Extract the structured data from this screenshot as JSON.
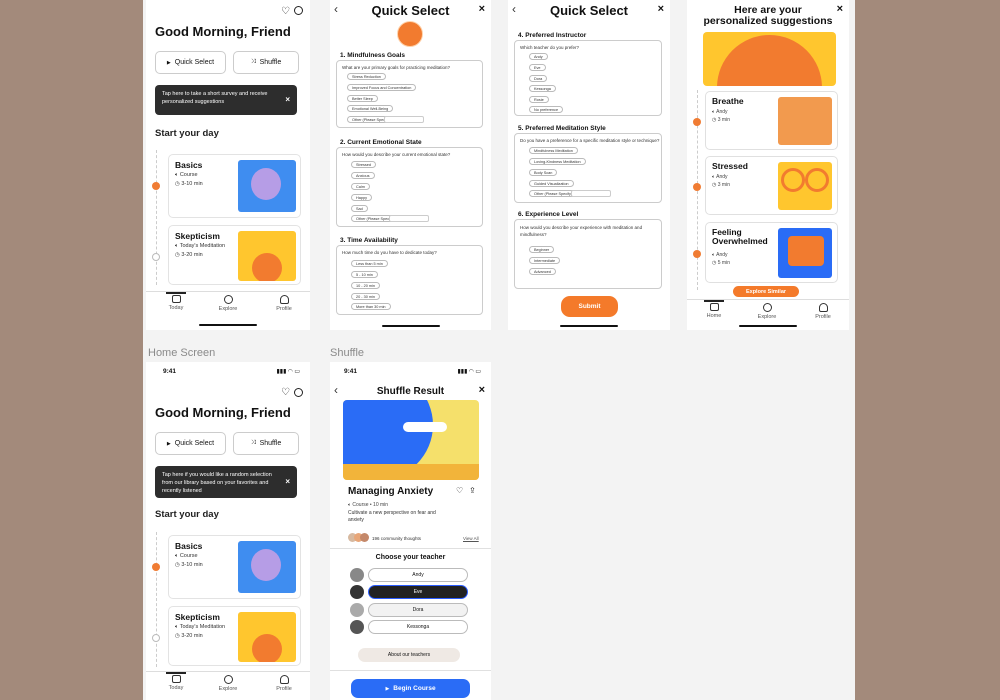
{
  "labels": {
    "home": "Home Screen",
    "shuffle": "Shuffle"
  },
  "home1": {
    "greeting": "Good Morning, Friend",
    "quick_select": "Quick Select",
    "shuffle": "Shuffle",
    "tooltip": "Tap here to take a short survey and receive personalized suggestions",
    "section": "Start your day",
    "cards": [
      {
        "title": "Basics",
        "type": "Course",
        "duration": "3-10 min"
      },
      {
        "title": "Skepticism",
        "type": "Today's Meditation",
        "duration": "3-20 min"
      }
    ],
    "tabs": [
      "Today",
      "Explore",
      "Profile"
    ]
  },
  "home2": {
    "time": "9:41",
    "greeting": "Good Morning, Friend",
    "quick_select": "Quick Select",
    "shuffle": "Shuffle",
    "tooltip": "Tap here if you would like a random selection from our library based on your favorites and recently listened",
    "section": "Start your day",
    "cards": [
      {
        "title": "Basics",
        "type": "Course",
        "duration": "3-10 min"
      },
      {
        "title": "Skepticism",
        "type": "Today's Meditation",
        "duration": "3-20 min"
      }
    ],
    "tabs": [
      "Today",
      "Explore",
      "Profile"
    ]
  },
  "qs1": {
    "title": "Quick Select",
    "q1": {
      "title": "1.  Mindfulness Goals",
      "sub": "What are your primary goals for practicing meditation?",
      "options": [
        "Stress Reduction",
        "Improved Focus and Concentration",
        "Better Sleep",
        "Emotional Well-Being",
        "Other (Please Specify)"
      ]
    },
    "q2": {
      "title": "2.  Current Emotional State",
      "sub": "How would you describe your current emotional state?",
      "options": [
        "Stressed",
        "Anxious",
        "Calm",
        "Happy",
        "Sad",
        "Other (Please Specify)"
      ]
    },
    "q3": {
      "title": "3.  Time Availability",
      "sub": "How much time do you have to dedicate today?",
      "options": [
        "Less than 5 min",
        "5 - 10 min",
        "10 - 20 min",
        "20 - 30 min",
        "More than 30 min"
      ]
    }
  },
  "qs2": {
    "title": "Quick Select",
    "q4": {
      "title": "4.  Preferred Instructor",
      "sub": "Which teacher do you prefer?",
      "options": [
        "Andy",
        "Eve",
        "Dora",
        "Kessonga",
        "Rosie",
        "No preference"
      ]
    },
    "q5": {
      "title": "5.  Preferred Meditation Style",
      "sub": "Do you have a preference for a specific meditation style or technique?",
      "options": [
        "Mindfulness Meditation",
        "Loving-Kindness Meditation",
        "Body Scan",
        "Guided Visualization",
        "Other (Please Specify)"
      ]
    },
    "q6": {
      "title": "6.  Experience Level",
      "sub": "How would you describe your experience with meditation and mindfulness?",
      "options": [
        "Beginner",
        "Intermediate",
        "Advanced"
      ]
    },
    "submit": "Submit"
  },
  "sugg": {
    "title": "Here are your personalized suggestions",
    "items": [
      {
        "title": "Breathe",
        "teacher": "Andy",
        "duration": "3 min"
      },
      {
        "title": "Stressed",
        "teacher": "Andy",
        "duration": "3 min"
      },
      {
        "title": "Feeling Overwhelmed",
        "teacher": "Andy",
        "duration": "5 min"
      }
    ],
    "explore_btn": "Explore Similar",
    "tabs": [
      "Home",
      "Explore",
      "Profile"
    ]
  },
  "shuf": {
    "time": "9:41",
    "title": "Shuffle Result",
    "item_title": "Managing Anxiety",
    "meta": "Course • 10 min",
    "desc": "Cultivate a new perspective on fear and anxiety",
    "community": "196 community thoughts",
    "community_link": "View All",
    "choose": "Choose your teacher",
    "teachers": [
      "Andy",
      "Eve",
      "Dora",
      "Kessonga"
    ],
    "about": "About our teachers",
    "begin": "Begin Course"
  },
  "colors": {
    "accent": "#f47a2a",
    "blue": "#2a6cf6",
    "bg": "#a38a7b"
  }
}
